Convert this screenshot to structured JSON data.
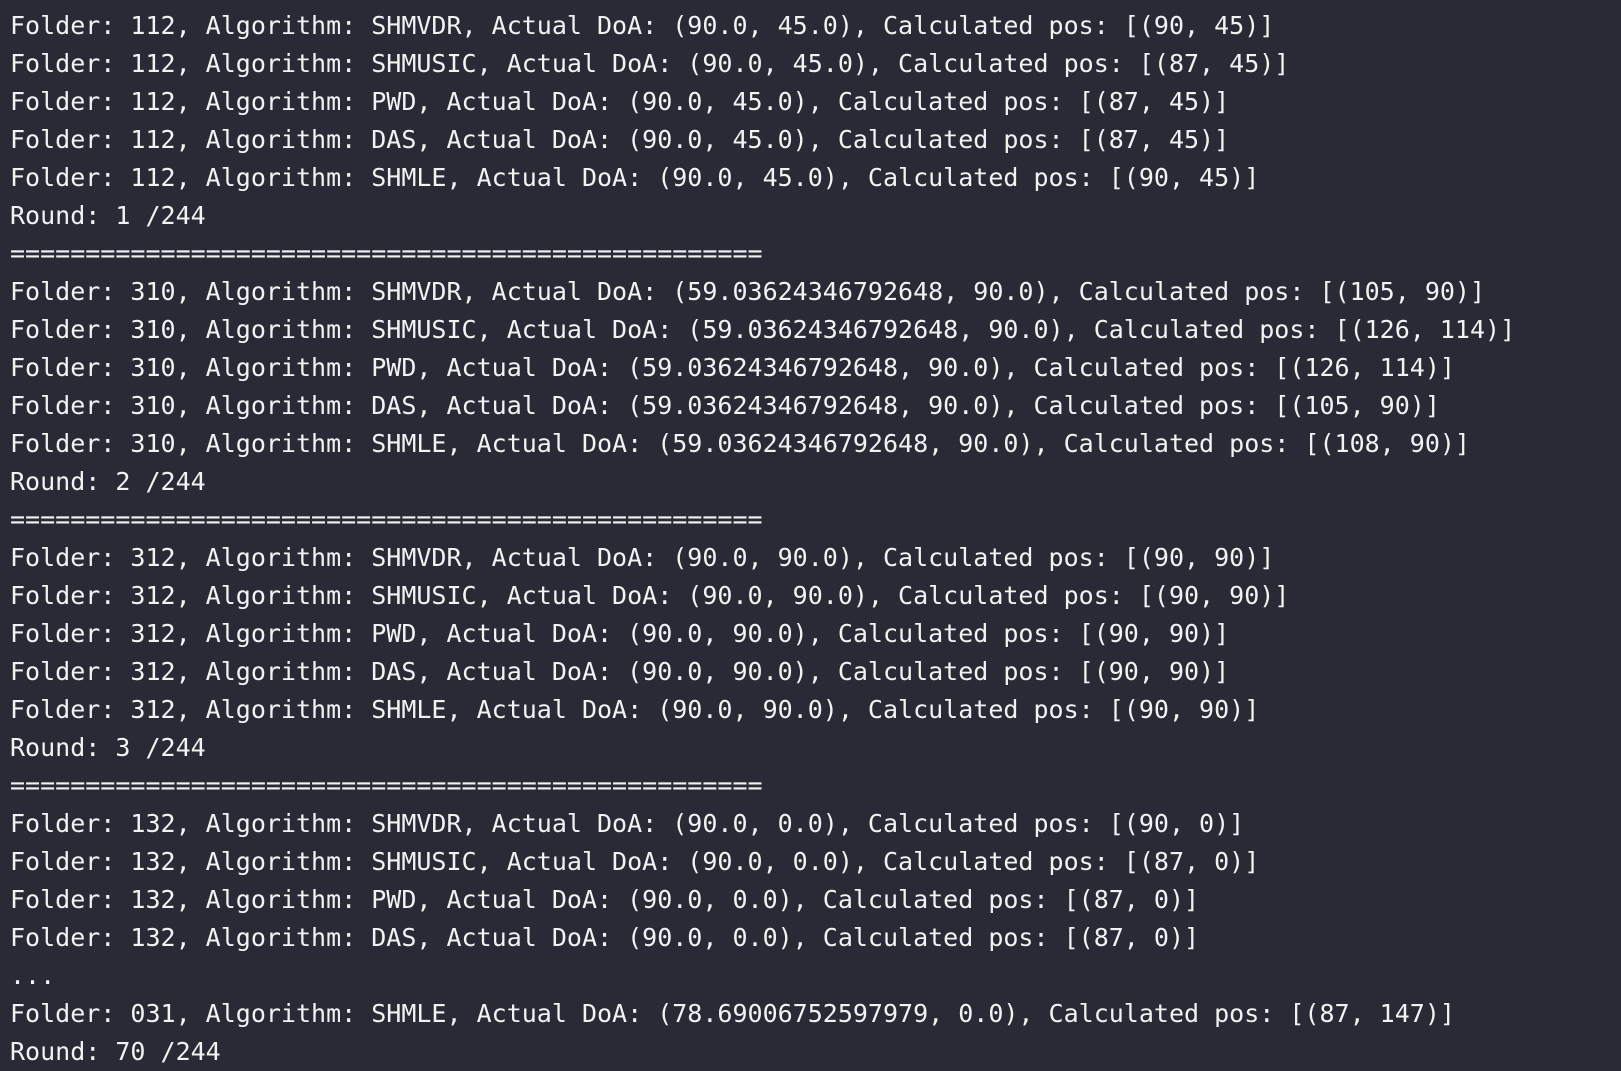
{
  "terminal": {
    "lines": [
      "Folder: 112, Algorithm: SHMVDR, Actual DoA: (90.0, 45.0), Calculated pos: [(90, 45)]",
      "Folder: 112, Algorithm: SHMUSIC, Actual DoA: (90.0, 45.0), Calculated pos: [(87, 45)]",
      "Folder: 112, Algorithm: PWD, Actual DoA: (90.0, 45.0), Calculated pos: [(87, 45)]",
      "Folder: 112, Algorithm: DAS, Actual DoA: (90.0, 45.0), Calculated pos: [(87, 45)]",
      "Folder: 112, Algorithm: SHMLE, Actual DoA: (90.0, 45.0), Calculated pos: [(90, 45)]",
      "Round: 1 /244",
      "==================================================",
      "Folder: 310, Algorithm: SHMVDR, Actual DoA: (59.03624346792648, 90.0), Calculated pos: [(105, 90)]",
      "Folder: 310, Algorithm: SHMUSIC, Actual DoA: (59.03624346792648, 90.0), Calculated pos: [(126, 114)]",
      "Folder: 310, Algorithm: PWD, Actual DoA: (59.03624346792648, 90.0), Calculated pos: [(126, 114)]",
      "Folder: 310, Algorithm: DAS, Actual DoA: (59.03624346792648, 90.0), Calculated pos: [(105, 90)]",
      "Folder: 310, Algorithm: SHMLE, Actual DoA: (59.03624346792648, 90.0), Calculated pos: [(108, 90)]",
      "Round: 2 /244",
      "==================================================",
      "Folder: 312, Algorithm: SHMVDR, Actual DoA: (90.0, 90.0), Calculated pos: [(90, 90)]",
      "Folder: 312, Algorithm: SHMUSIC, Actual DoA: (90.0, 90.0), Calculated pos: [(90, 90)]",
      "Folder: 312, Algorithm: PWD, Actual DoA: (90.0, 90.0), Calculated pos: [(90, 90)]",
      "Folder: 312, Algorithm: DAS, Actual DoA: (90.0, 90.0), Calculated pos: [(90, 90)]",
      "Folder: 312, Algorithm: SHMLE, Actual DoA: (90.0, 90.0), Calculated pos: [(90, 90)]",
      "Round: 3 /244",
      "==================================================",
      "Folder: 132, Algorithm: SHMVDR, Actual DoA: (90.0, 0.0), Calculated pos: [(90, 0)]",
      "Folder: 132, Algorithm: SHMUSIC, Actual DoA: (90.0, 0.0), Calculated pos: [(87, 0)]",
      "Folder: 132, Algorithm: PWD, Actual DoA: (90.0, 0.0), Calculated pos: [(87, 0)]",
      "Folder: 132, Algorithm: DAS, Actual DoA: (90.0, 0.0), Calculated pos: [(87, 0)]",
      "...",
      "Folder: 031, Algorithm: SHMLE, Actual DoA: (78.69006752597979, 0.0), Calculated pos: [(87, 147)]",
      "Round: 70 /244"
    ]
  }
}
